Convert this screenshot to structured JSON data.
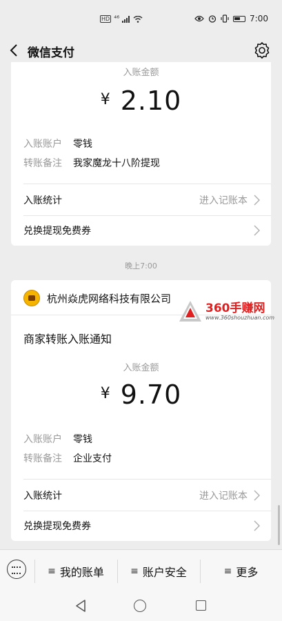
{
  "status_bar": {
    "hd": "HD",
    "signal": "⁴⁶",
    "time": "7:00"
  },
  "header": {
    "title": "微信支付"
  },
  "card1": {
    "amount_label": "入账金额",
    "currency": "¥",
    "amount": "2.10",
    "account_key": "入账账户",
    "account_value": "零钱",
    "note_key": "转账备注",
    "note_value": "我家魔龙十八阶提现",
    "stats_label": "入账统计",
    "stats_link": "进入记账本",
    "voucher_label": "兑换提现免费券"
  },
  "time_separator": "晚上7:00",
  "card2": {
    "merchant": "杭州焱虎网络科技有限公司",
    "notice_title": "商家转账入账通知",
    "amount_label": "入账金额",
    "currency": "¥",
    "amount": "9.70",
    "account_key": "入账账户",
    "account_value": "零钱",
    "note_key": "转账备注",
    "note_value": "企业支付",
    "stats_label": "入账统计",
    "stats_link": "进入记账本",
    "voucher_label": "兑换提现免费券"
  },
  "watermark": {
    "brand": "360手赚网",
    "url": "www.360shouzhuan.com"
  },
  "menu": {
    "items": [
      {
        "label": "我的账单"
      },
      {
        "label": "账户安全"
      },
      {
        "label": "更多"
      }
    ],
    "hamburger": "≡"
  },
  "icons": {
    "back": "chevron-left-icon",
    "settings": "gear-icon",
    "keyboard": "keyboard-icon"
  }
}
